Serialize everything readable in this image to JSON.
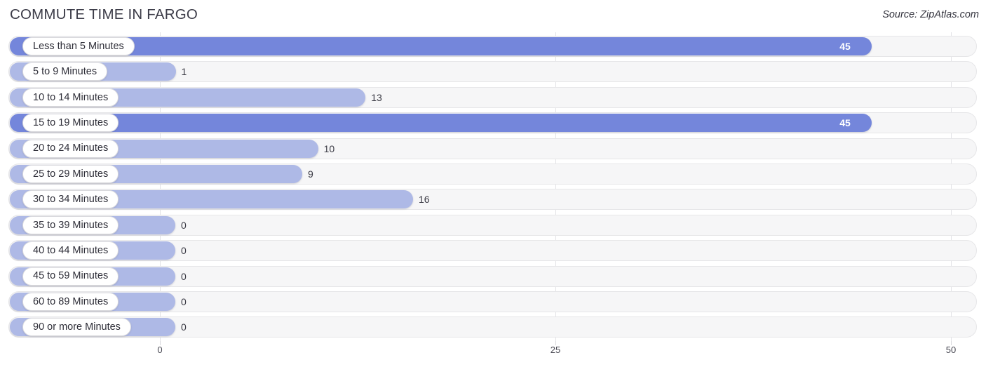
{
  "header": {
    "title": "COMMUTE TIME IN FARGO",
    "source": "Source: ZipAtlas.com"
  },
  "chart_data": {
    "type": "bar",
    "orientation": "horizontal",
    "title": "COMMUTE TIME IN FARGO",
    "xlabel": "",
    "ylabel": "",
    "xlim": [
      0,
      50
    ],
    "xticks": [
      "0",
      "25",
      "50"
    ],
    "xtick_values": [
      0,
      25,
      50
    ],
    "grid": true,
    "legend": false,
    "categories": [
      "Less than 5 Minutes",
      "5 to 9 Minutes",
      "10 to 14 Minutes",
      "15 to 19 Minutes",
      "20 to 24 Minutes",
      "25 to 29 Minutes",
      "30 to 34 Minutes",
      "35 to 39 Minutes",
      "40 to 44 Minutes",
      "45 to 59 Minutes",
      "60 to 89 Minutes",
      "90 or more Minutes"
    ],
    "values": [
      45,
      1,
      13,
      45,
      10,
      9,
      16,
      0,
      0,
      0,
      0,
      0
    ],
    "value_labels": [
      "45",
      "1",
      "13",
      "45",
      "10",
      "9",
      "16",
      "0",
      "0",
      "0",
      "0",
      "0"
    ],
    "colors": {
      "bar_normal": "#aeb9e6",
      "bar_max": "#7486db",
      "track_fill": "#f6f6f7",
      "track_border": "#e6e6e8",
      "gridline": "#e2e2e6",
      "value_text_outside": "#3a3a44",
      "value_text_inside": "#ffffff"
    }
  }
}
